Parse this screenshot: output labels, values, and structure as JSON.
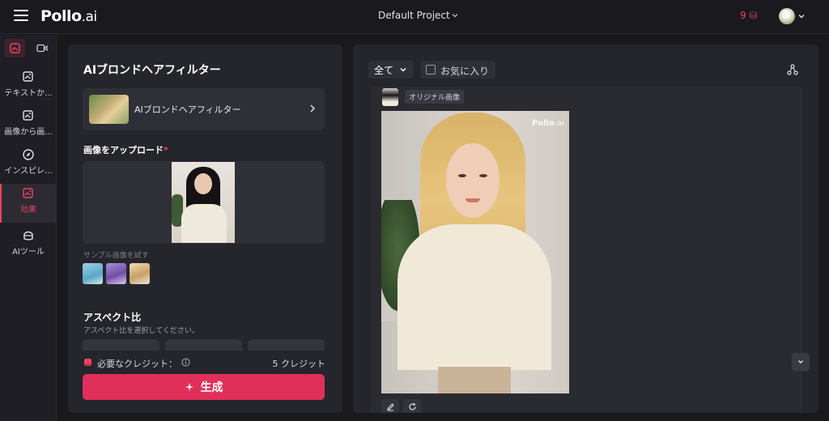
{
  "topbar": {
    "logo_main": "Pollo",
    "logo_suffix": ".ai",
    "project_name": "Default Project",
    "credits": "9"
  },
  "rail": {
    "items": [
      {
        "label": "テキストか..."
      },
      {
        "label": "画像から画..."
      },
      {
        "label": "インスピレ..."
      },
      {
        "label": "効果"
      },
      {
        "label": "AIツール"
      }
    ]
  },
  "left_panel": {
    "title": "AIブロンドヘアフィルター",
    "effect_name": "AIブロンドヘアフィルター",
    "upload_label": "画像をアップロード",
    "required_mark": "*",
    "sample_label": "サンプル画像を試す",
    "aspect_title": "アスペクト比",
    "aspect_subtitle": "アスペクト比を選択してください。",
    "credit_label": "必要なクレジット：",
    "credit_amount": "5 クレジット",
    "generate_label": "生成"
  },
  "right_panel": {
    "filter_all": "全て",
    "favorites": "お気に入り",
    "original_tag": "オリジナル画像",
    "watermark_main": "Pollo",
    "watermark_suffix": ".ai"
  },
  "colors": {
    "accent": "#e0305a",
    "background": "#19191e",
    "panel": "#25252c"
  }
}
